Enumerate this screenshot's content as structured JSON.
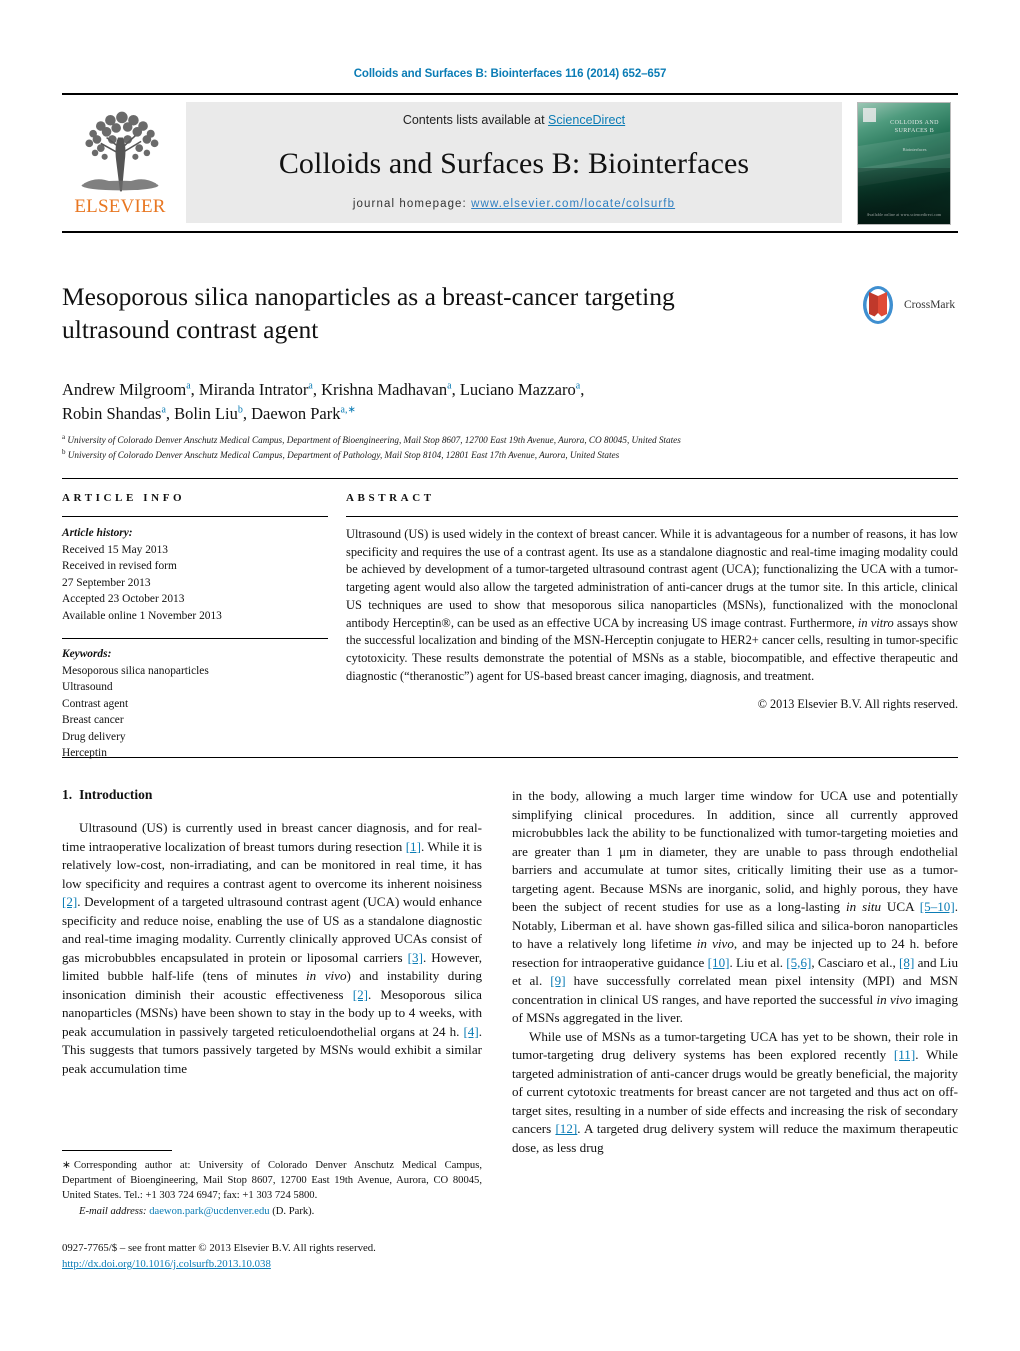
{
  "running_head": "Colloids and Surfaces B: Biointerfaces 116 (2014) 652–657",
  "masthead": {
    "publisher_name": "ELSEVIER",
    "contents_prefix": "Contents lists available at ",
    "contents_link": "ScienceDirect",
    "journal_title": "Colloids and Surfaces B: Biointerfaces",
    "homepage_label": "journal homepage: ",
    "homepage_url": "www.elsevier.com/locate/colsurfb",
    "cover": {
      "title_line1": "COLLOIDS AND",
      "title_line2": "SURFACES B",
      "kicker": "An International Journal of",
      "subtitle": "Biointerfaces",
      "footer": "Available online at www.sciencedirect.com"
    }
  },
  "crossmark": {
    "label": "CrossMark"
  },
  "article": {
    "title_line1": "Mesoporous silica nanoparticles as a breast-cancer targeting",
    "title_line2": "ultrasound contrast agent",
    "authors": [
      {
        "name": "Andrew Milgroom",
        "marks": "a",
        "sep": ", "
      },
      {
        "name": "Miranda Intrator",
        "marks": "a",
        "sep": ", "
      },
      {
        "name": "Krishna Madhavan",
        "marks": "a",
        "sep": ", "
      },
      {
        "name": "Luciano Mazzaro",
        "marks": "a",
        "sep": ", "
      },
      {
        "name": "Robin Shandas",
        "marks": "a",
        "sep": ", "
      },
      {
        "name": "Bolin Liu",
        "marks": "b",
        "sep": ", "
      },
      {
        "name": "Daewon Park",
        "marks": "a,∗",
        "sep": ""
      }
    ],
    "affiliation_a_mark": "a",
    "affiliation_a": "University of Colorado Denver Anschutz Medical Campus, Department of Bioengineering, Mail Stop 8607, 12700 East 19th Avenue, Aurora, CO 80045, United States",
    "affiliation_b_mark": "b",
    "affiliation_b": "University of Colorado Denver Anschutz Medical Campus, Department of Pathology, Mail Stop 8104, 12801 East 17th Avenue, Aurora, United States"
  },
  "article_info": {
    "heading": "ARTICLE INFO",
    "history_label": "Article history:",
    "history": [
      "Received 15 May 2013",
      "Received in revised form",
      "27 September 2013",
      "Accepted 23 October 2013",
      "Available online 1 November 2013"
    ],
    "keywords_label": "Keywords:",
    "keywords": [
      "Mesoporous silica nanoparticles",
      "Ultrasound",
      "Contrast agent",
      "Breast cancer",
      "Drug delivery",
      "Herceptin"
    ]
  },
  "abstract": {
    "heading": "ABSTRACT",
    "part1": "Ultrasound (US) is used widely in the context of breast cancer. While it is advantageous for a number of reasons, it has low specificity and requires the use of a contrast agent. Its use as a standalone diagnostic and real-time imaging modality could be achieved by development of a tumor-targeted ultrasound contrast agent (UCA); functionalizing the UCA with a tumor-targeting agent would also allow the targeted administration of anti-cancer drugs at the tumor site. In this article, clinical US techniques are used to show that mesoporous silica nanoparticles (MSNs), functionalized with the monoclonal antibody Herceptin®, can be used as an effective UCA by increasing US image contrast. Furthermore, ",
    "italic1": "in vitro",
    "part2": " assays show the successful localization and binding of the MSN-Herceptin conjugate to HER2+ cancer cells, resulting in tumor-specific cytotoxicity. These results demonstrate the potential of MSNs as a stable, biocompatible, and effective therapeutic and diagnostic (“theranostic”) agent for US-based breast cancer imaging, diagnosis, and treatment.",
    "copyright": "© 2013 Elsevier B.V. All rights reserved."
  },
  "section": {
    "number": "1.",
    "heading": "Introduction"
  },
  "body": {
    "left_p1_a": "Ultrasound (US) is currently used in breast cancer diagnosis, and for real-time intraoperative localization of breast tumors during resection ",
    "left_p1_r1": "[1]",
    "left_p1_b": ". While it is relatively low-cost, non-irradiating, and can be monitored in real time, it has low specificity and requires a contrast agent to overcome its inherent noisiness ",
    "left_p1_r2": "[2]",
    "left_p1_c": ". Development of a targeted ultrasound contrast agent (UCA) would enhance specificity and reduce noise, enabling the use of US as a standalone diagnostic and real-time imaging modality. Currently clinically approved UCAs consist of gas microbubbles encapsulated in protein or liposomal carriers ",
    "left_p1_r3": "[3]",
    "left_p1_d": ". However, limited bubble half-life (tens of minutes ",
    "left_p1_i1": "in vivo",
    "left_p1_e": ") and instability during insonication diminish their acoustic effectiveness ",
    "left_p1_r4": "[2]",
    "left_p1_f": ". Mesoporous silica nanoparticles (MSNs) have been shown to stay in the body up to 4 weeks, with peak accumulation in passively targeted reticuloendothelial organs at 24 h. ",
    "left_p1_r5": "[4]",
    "left_p1_g": ". This suggests that tumors passively targeted by MSNs would exhibit a similar peak accumulation time",
    "right_p1_a": "in the body, allowing a much larger time window for UCA use and potentially simplifying clinical procedures. In addition, since all currently approved microbubbles lack the ability to be functionalized with tumor-targeting moieties and are greater than 1 μm in diameter, they are unable to pass through endothelial barriers and accumulate at tumor sites, critically limiting their use as a tumor-targeting agent. Because MSNs are inorganic, solid, and highly porous, they have been the subject of recent studies for use as a long-lasting ",
    "right_p1_i1": "in situ",
    "right_p1_b": " UCA ",
    "right_p1_r1": "[5–10]",
    "right_p1_c": ". Notably, Liberman et al. have shown gas-filled silica and silica-boron nanoparticles to have a relatively long lifetime ",
    "right_p1_i2": "in vivo",
    "right_p1_d": ", and may be injected up to 24 h. before resection for intraoperative guidance ",
    "right_p1_r2": "[10]",
    "right_p1_e": ". Liu et al. ",
    "right_p1_r3": "[5,6]",
    "right_p1_f": ", Casciaro et al., ",
    "right_p1_r4": "[8]",
    "right_p1_g": " and Liu et al. ",
    "right_p1_r5": "[9]",
    "right_p1_h": " have successfully correlated mean pixel intensity (MPI) and MSN concentration in clinical US ranges, and have reported the successful ",
    "right_p1_i3": "in vivo",
    "right_p1_i": " imaging of MSNs aggregated in the liver.",
    "right_p2_a": "While use of MSNs as a tumor-targeting UCA has yet to be shown, their role in tumor-targeting drug delivery systems has been explored recently ",
    "right_p2_r1": "[11]",
    "right_p2_b": ". While targeted administration of anti-cancer drugs would be greatly beneficial, the majority of current cytotoxic treatments for breast cancer are not targeted and thus act on off-target sites, resulting in a number of side effects and increasing the risk of secondary cancers ",
    "right_p2_r2": "[12]",
    "right_p2_c": ". A targeted drug delivery system will reduce the maximum therapeutic dose, as less drug"
  },
  "footnote": {
    "star": "∗",
    "text": "Corresponding author at: University of Colorado Denver Anschutz Medical Campus, Department of Bioengineering, Mail Stop 8607, 12700 East 19th Avenue, Aurora, CO 80045, United States. Tel.: +1 303 724 6947; fax: +1 303 724 5800.",
    "email_label": "E-mail address:",
    "email": "daewon.park@ucdenver.edu",
    "email_suffix": "(D. Park)."
  },
  "imprint": {
    "line1": "0927-7765/$ – see front matter © 2013 Elsevier B.V. All rights reserved.",
    "doi": "http://dx.doi.org/10.1016/j.colsurfb.2013.10.038"
  },
  "colors": {
    "link_blue": "#0b7cb5",
    "elsevier_orange": "#e87722",
    "masthead_grey": "#eaeaea"
  }
}
